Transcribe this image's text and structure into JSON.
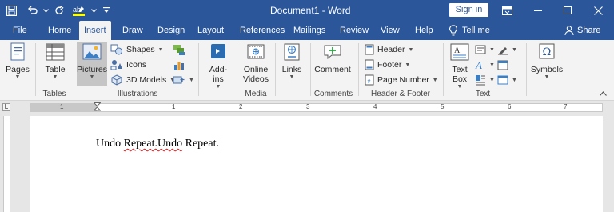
{
  "titlebar": {
    "title": "Document1 - Word",
    "signin_label": "Sign in",
    "bg_color": "#2b579a"
  },
  "qat": {
    "items": [
      "save-icon",
      "undo-icon",
      "redo-icon",
      "highlight-icon",
      "customize-icon"
    ]
  },
  "tabs": {
    "items": [
      "File",
      "Home",
      "Insert",
      "Draw",
      "Design",
      "Layout",
      "References",
      "Mailings",
      "Review",
      "View",
      "Help"
    ],
    "active": "Insert",
    "tell_me": "Tell me",
    "share": "Share"
  },
  "ribbon": {
    "pages": {
      "label": "Pages"
    },
    "tables": {
      "table_label": "Table",
      "group_label": "Tables"
    },
    "illustrations": {
      "pictures_label": "Pictures",
      "shapes_label": "Shapes",
      "icons_label": "Icons",
      "models_label": "3D Models",
      "group_label": "Illustrations"
    },
    "addins": {
      "label": "Add-\nins"
    },
    "media": {
      "video_label": "Online\nVideos",
      "group_label": "Media"
    },
    "links": {
      "label": "Links"
    },
    "comments": {
      "comment_label": "Comment",
      "group_label": "Comments"
    },
    "header_footer": {
      "header_label": "Header",
      "footer_label": "Footer",
      "page_number_label": "Page Number",
      "group_label": "Header & Footer"
    },
    "text": {
      "textbox_label": "Text\nBox",
      "group_label": "Text"
    },
    "symbols": {
      "label": "Symbols"
    }
  },
  "ruler": {
    "numbers": [
      "1",
      "1",
      "2",
      "3",
      "4",
      "5",
      "6",
      "7"
    ]
  },
  "document": {
    "text_before": "Undo ",
    "text_error": "Repeat.Undo",
    "text_after": " Repeat."
  }
}
